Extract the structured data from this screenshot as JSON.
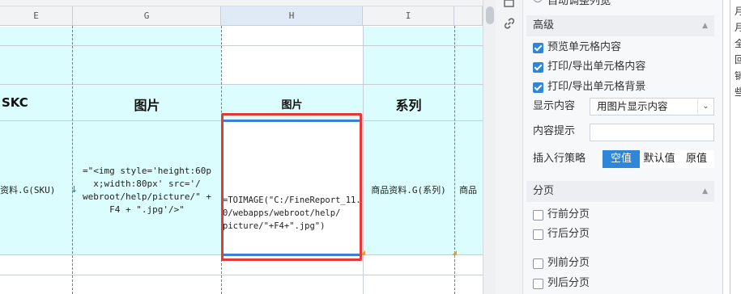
{
  "sheet": {
    "columns": [
      "E",
      "G",
      "H",
      "I"
    ],
    "selected_column": "H",
    "header_row": {
      "e": "SKC",
      "g": "图片",
      "h": "图片",
      "i": "系列"
    },
    "data_row": {
      "e": "资料.G(SKU)",
      "g": "=\"<img style='height:60p\nx;width:80px' src='/\nwebroot/help/picture/\" +\nF4 + \".jpg'/>\"",
      "h": "=TOIMAGE(\"C:/FineReport_11.\n0/webapps/webroot/help/\npicture/\"+F4+\".jpg\")",
      "i": "商品资料.G(系列)",
      "j": "商品"
    }
  },
  "panel": {
    "top_partial_label": "自动调整列宽",
    "advanced": {
      "title": "高级",
      "preview_cell_content": "预览单元格内容",
      "print_export_content": "打印/导出单元格内容",
      "print_export_background": "打印/导出单元格背景",
      "display_content_label": "显示内容",
      "display_content_value": "用图片显示内容",
      "content_tip_label": "内容提示",
      "content_tip_value": "",
      "insert_policy_label": "插入行策略",
      "insert_policy_options": [
        "空值",
        "默认值",
        "原值"
      ],
      "insert_policy_selected": "空值"
    },
    "paging": {
      "title": "分页",
      "items": [
        "行前分页",
        "行后分页",
        "列前分页",
        "列后分页"
      ]
    },
    "far_strip_chars": [
      "月",
      "月",
      "全",
      "回",
      "销",
      "些"
    ]
  },
  "colors": {
    "selection_red": "#e53935",
    "checkbox_blue": "#2f86d9",
    "cell_cyan": "#dcfdfd"
  }
}
